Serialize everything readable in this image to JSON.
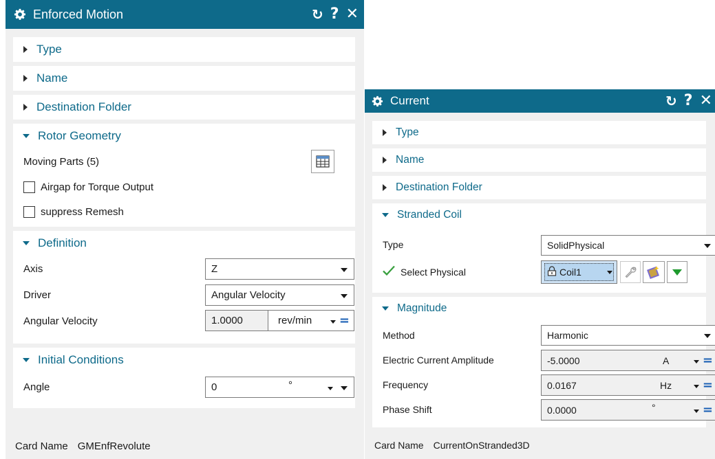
{
  "dialog_enforced": {
    "title": "Enforced Motion",
    "controls": {
      "reset": "↻",
      "help": "?",
      "close": "✕"
    },
    "groups": {
      "type": "Type",
      "name": "Name",
      "destination": "Destination Folder",
      "rotor": {
        "title": "Rotor Geometry",
        "moving_parts": "Moving Parts (5)",
        "airgap": "Airgap for Torque Output",
        "suppress": "suppress Remesh"
      },
      "definition": {
        "title": "Definition",
        "axis_label": "Axis",
        "axis_value": "Z",
        "driver_label": "Driver",
        "driver_value": "Angular Velocity",
        "velocity_label": "Angular Velocity",
        "velocity_value": "1.0000",
        "velocity_unit": "rev/min",
        "equals": "="
      },
      "initial": {
        "title": "Initial Conditions",
        "angle_label": "Angle",
        "angle_value": "0",
        "angle_unit": "°"
      }
    },
    "footer": {
      "label": "Card Name",
      "value": "GMEnfRevolute"
    }
  },
  "dialog_current": {
    "title": "Current",
    "controls": {
      "reset": "↻",
      "help": "?",
      "close": "✕"
    },
    "groups": {
      "type": "Type",
      "name": "Name",
      "destination": "Destination Folder",
      "coil": {
        "title": "Stranded Coil",
        "type_label": "Type",
        "type_value": "SolidPhysical",
        "select_label": "Select Physical",
        "select_value": "Coil1"
      },
      "magnitude": {
        "title": "Magnitude",
        "method_label": "Method",
        "method_value": "Harmonic",
        "amplitude_label": "Electric Current Amplitude",
        "amplitude_value": "-5.0000",
        "amplitude_unit": "A",
        "frequency_label": "Frequency",
        "frequency_value": "0.0167",
        "frequency_unit": "Hz",
        "phase_label": "Phase Shift",
        "phase_value": "0.0000",
        "phase_unit": "°",
        "equals": "="
      }
    },
    "footer": {
      "label": "Card Name",
      "value": "CurrentOnStranded3D"
    }
  },
  "colors": {
    "titlebar": "#0e6a8a",
    "accent_text": "#0e6a8a",
    "equals_blue": "#1a5fb4",
    "check_green": "#3aa040",
    "dialog_bg": "#f0f0f0"
  }
}
